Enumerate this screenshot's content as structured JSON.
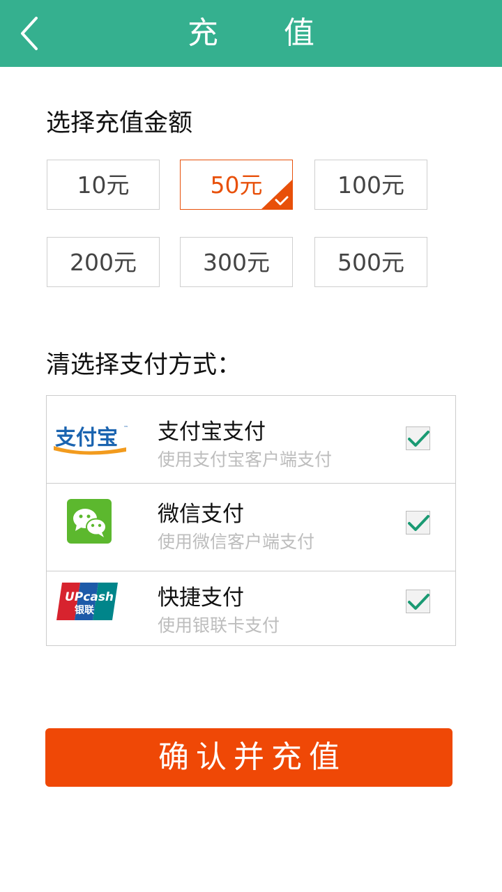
{
  "header": {
    "title": "充 值",
    "back_icon": "chevron-left-icon"
  },
  "amount_section": {
    "title": "选择充值金额",
    "options": [
      {
        "label": "10元",
        "selected": false
      },
      {
        "label": "50元",
        "selected": true
      },
      {
        "label": "100元",
        "selected": false
      },
      {
        "label": "200元",
        "selected": false
      },
      {
        "label": "300元",
        "selected": false
      },
      {
        "label": "500元",
        "selected": false
      }
    ]
  },
  "payment_section": {
    "title": "清选择支付方式：",
    "methods": [
      {
        "name": "支付宝支付",
        "description": "使用支付宝客户端支付",
        "icon": "alipay-logo",
        "logo_text": "支付宝",
        "checked": true
      },
      {
        "name": "微信支付",
        "description": "使用微信客户端支付",
        "icon": "wechat-logo",
        "checked": true
      },
      {
        "name": "快捷支付",
        "description": "使用银联卡支付",
        "icon": "unionpay-logo",
        "logo_text": [
          "UPcash",
          "银联"
        ],
        "checked": true
      }
    ]
  },
  "confirm_button": {
    "label": "确认并充值"
  },
  "colors": {
    "header_bg": "#35b08f",
    "accent": "#ef4806",
    "selected_border": "#e8500a",
    "check_mark": "#1a9a73"
  }
}
